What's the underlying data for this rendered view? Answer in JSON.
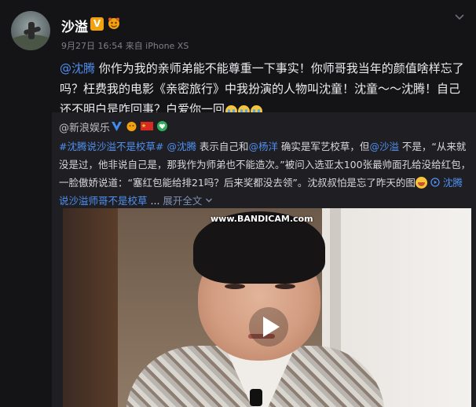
{
  "post": {
    "username": "沙溢",
    "vip_badge": "V",
    "meta": "9月27日 16:54 来自 iPhone XS",
    "content": {
      "mention": "@沈腾",
      "text_after_mention": " 你作为我的亲师弟能不能尊重一下事实！你师哥我当年的颜值啥样忘了吗？枉费我的电影《亲密旅行》中我扮演的人物叫沈童！沈童～～沈腾！自己还不明白是咋回事？白爱你一回"
    }
  },
  "repost": {
    "author": "@新浪娱乐",
    "text": {
      "hashtag": "#沈腾说沙溢不是校草#",
      "mention1": "@沈腾",
      "part1": " 表示自己和",
      "mention2": "@杨洋",
      "part2": " 确实是军艺校草，但",
      "mention3": "@沙溢",
      "part3": " 不是，“从来就没是过，他非说自己是，那我作为师弟也不能造次。”被问入选亚太100张最帅面孔给没给红包，一脸傲娇说道：“塞红包能给排21吗？后来奖都没去领”。沈叔叔怕是忘了昨天的图",
      "link_label": "沈腾说沙溢师哥不是校草",
      "ellipsis": "...",
      "expand_label": "展开全文",
      "expand_icon": "chevron-down-icon"
    },
    "video": {
      "watermark": "www.BANDICAM.com",
      "play_icon": "play-icon"
    }
  },
  "colors": {
    "background": "#141417",
    "repost_background": "#1f1f23",
    "link": "#4f8ff0",
    "vip_badge": "#f2a20c"
  }
}
